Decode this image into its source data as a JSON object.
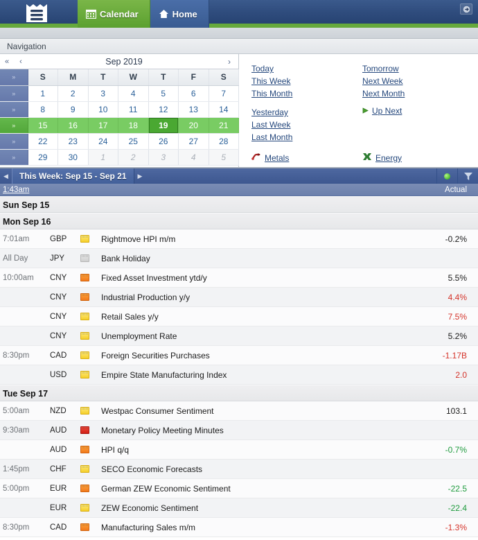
{
  "header": {
    "logo_icon": "ledger-icon",
    "tabs": [
      {
        "label": "Calendar",
        "icon": "calendar-icon",
        "active": true
      },
      {
        "label": "Home",
        "icon": "home-icon",
        "active": false
      }
    ],
    "login_icon": "login-arrow-icon"
  },
  "navigation": {
    "title": "Navigation",
    "calendar": {
      "month_label": "Sep 2019",
      "prev_year_icon": "double-chevron-left-icon",
      "prev_month_icon": "chevron-left-icon",
      "next_month_icon": "chevron-right-icon",
      "week_select_icon": "double-chevron-right-icon",
      "weekday_headers": [
        "S",
        "M",
        "T",
        "W",
        "T",
        "F",
        "S"
      ],
      "weeks": [
        {
          "selected": false,
          "days": [
            {
              "n": "1",
              "out": false
            },
            {
              "n": "2",
              "out": false
            },
            {
              "n": "3",
              "out": false
            },
            {
              "n": "4",
              "out": false
            },
            {
              "n": "5",
              "out": false
            },
            {
              "n": "6",
              "out": false
            },
            {
              "n": "7",
              "out": false
            }
          ]
        },
        {
          "selected": false,
          "days": [
            {
              "n": "8",
              "out": false
            },
            {
              "n": "9",
              "out": false
            },
            {
              "n": "10",
              "out": false
            },
            {
              "n": "11",
              "out": false
            },
            {
              "n": "12",
              "out": false
            },
            {
              "n": "13",
              "out": false
            },
            {
              "n": "14",
              "out": false
            }
          ]
        },
        {
          "selected": true,
          "days": [
            {
              "n": "15",
              "out": false
            },
            {
              "n": "16",
              "out": false
            },
            {
              "n": "17",
              "out": false
            },
            {
              "n": "18",
              "out": false
            },
            {
              "n": "19",
              "out": false,
              "today": true
            },
            {
              "n": "20",
              "out": false
            },
            {
              "n": "21",
              "out": false
            }
          ]
        },
        {
          "selected": false,
          "days": [
            {
              "n": "22",
              "out": false
            },
            {
              "n": "23",
              "out": false
            },
            {
              "n": "24",
              "out": false
            },
            {
              "n": "25",
              "out": false
            },
            {
              "n": "26",
              "out": false
            },
            {
              "n": "27",
              "out": false
            },
            {
              "n": "28",
              "out": false
            }
          ]
        },
        {
          "selected": false,
          "days": [
            {
              "n": "29",
              "out": false
            },
            {
              "n": "30",
              "out": false
            },
            {
              "n": "1",
              "out": true
            },
            {
              "n": "2",
              "out": true
            },
            {
              "n": "3",
              "out": true
            },
            {
              "n": "4",
              "out": true
            },
            {
              "n": "5",
              "out": true
            }
          ]
        }
      ]
    },
    "links_left": [
      "Today",
      "This Week",
      "This Month"
    ],
    "links_left2": [
      "Yesterday",
      "Last Week",
      "Last Month"
    ],
    "links_right": [
      "Tomorrow",
      "Next Week",
      "Next Month"
    ],
    "up_next": {
      "label": "Up Next",
      "icon": "play-triangle-icon"
    },
    "metals": {
      "label": "Metals",
      "icon": "metals-icon"
    },
    "energy": {
      "label": "Energy",
      "icon": "energy-icon"
    }
  },
  "weekbar": {
    "prev_icon": "triangle-left-icon",
    "title": "This Week: Sep 15 - Sep 21",
    "next_icon": "triangle-right-icon",
    "play_icon": "green-play-icon",
    "filter_icon": "filter-funnel-icon"
  },
  "columns": {
    "time": "1:43am",
    "actual": "Actual"
  },
  "days": [
    {
      "date_label": "Sun Sep 15",
      "events": []
    },
    {
      "date_label": "Mon Sep 16",
      "events": [
        {
          "time": "7:01am",
          "currency": "GBP",
          "impact": "yellow",
          "name": "Rightmove HPI m/m",
          "actual": "-0.2%",
          "tone": "neu"
        },
        {
          "time": "All Day",
          "currency": "JPY",
          "impact": "gray",
          "name": "Bank Holiday",
          "actual": "",
          "tone": "neu"
        },
        {
          "time": "10:00am",
          "currency": "CNY",
          "impact": "orange",
          "name": "Fixed Asset Investment ytd/y",
          "actual": "5.5%",
          "tone": "neu"
        },
        {
          "time": "",
          "currency": "CNY",
          "impact": "orange",
          "name": "Industrial Production y/y",
          "actual": "4.4%",
          "tone": "neg"
        },
        {
          "time": "",
          "currency": "CNY",
          "impact": "yellow",
          "name": "Retail Sales y/y",
          "actual": "7.5%",
          "tone": "neg"
        },
        {
          "time": "",
          "currency": "CNY",
          "impact": "yellow",
          "name": "Unemployment Rate",
          "actual": "5.2%",
          "tone": "neu"
        },
        {
          "time": "8:30pm",
          "currency": "CAD",
          "impact": "yellow",
          "name": "Foreign Securities Purchases",
          "actual": "-1.17B",
          "tone": "neg"
        },
        {
          "time": "",
          "currency": "USD",
          "impact": "yellow",
          "name": "Empire State Manufacturing Index",
          "actual": "2.0",
          "tone": "neg"
        }
      ]
    },
    {
      "date_label": "Tue Sep 17",
      "events": [
        {
          "time": "5:00am",
          "currency": "NZD",
          "impact": "yellow",
          "name": "Westpac Consumer Sentiment",
          "actual": "103.1",
          "tone": "neu"
        },
        {
          "time": "9:30am",
          "currency": "AUD",
          "impact": "red",
          "name": "Monetary Policy Meeting Minutes",
          "actual": "",
          "tone": "neu"
        },
        {
          "time": "",
          "currency": "AUD",
          "impact": "orange",
          "name": "HPI q/q",
          "actual": "-0.7%",
          "tone": "pos"
        },
        {
          "time": "1:45pm",
          "currency": "CHF",
          "impact": "yellow",
          "name": "SECO Economic Forecasts",
          "actual": "",
          "tone": "neu"
        },
        {
          "time": "5:00pm",
          "currency": "EUR",
          "impact": "orange",
          "name": "German ZEW Economic Sentiment",
          "actual": "-22.5",
          "tone": "pos"
        },
        {
          "time": "",
          "currency": "EUR",
          "impact": "yellow",
          "name": "ZEW Economic Sentiment",
          "actual": "-22.4",
          "tone": "pos"
        },
        {
          "time": "8:30pm",
          "currency": "CAD",
          "impact": "orange",
          "name": "Manufacturing Sales m/m",
          "actual": "-1.3%",
          "tone": "neg"
        }
      ]
    }
  ]
}
